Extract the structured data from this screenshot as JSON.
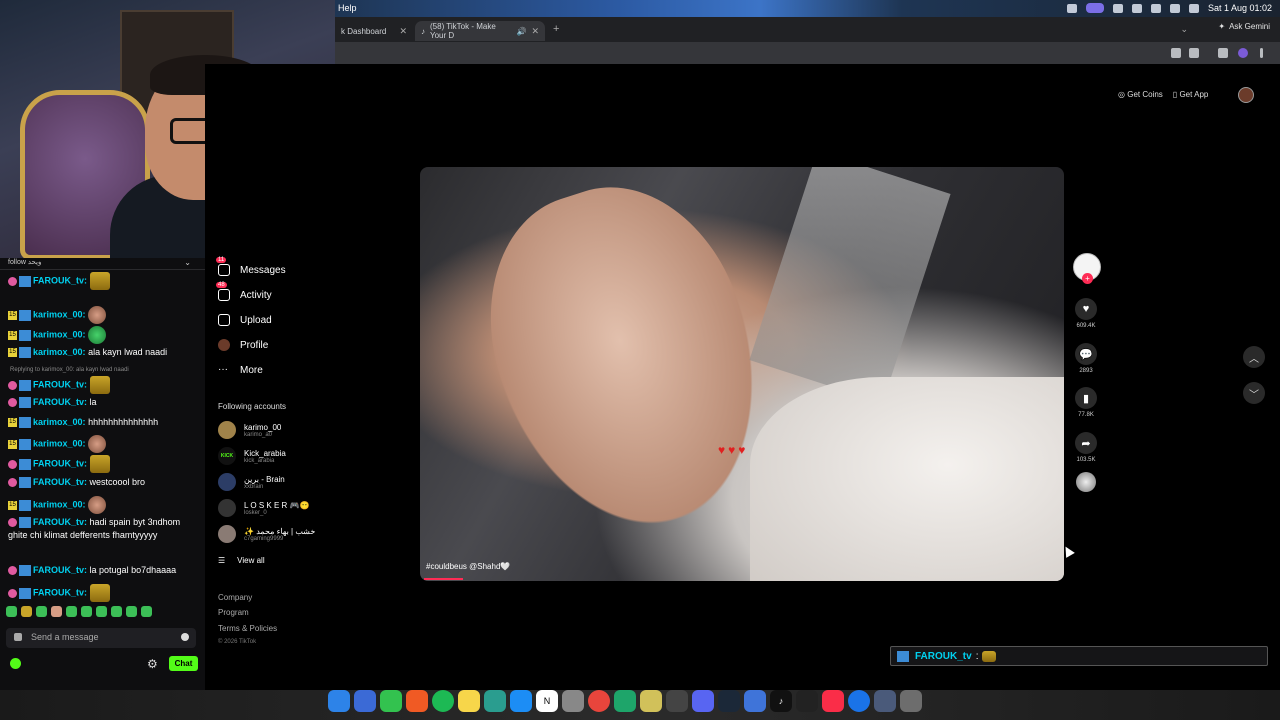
{
  "menubar": {
    "help": "Help",
    "datetime": "Sat 1 Aug  01:02"
  },
  "tabs": [
    {
      "label": "k Dashboard"
    },
    {
      "label": "(58) TikTok - Make Your D"
    }
  ],
  "browser": {
    "ask_gemini": "Ask Gemini"
  },
  "chat": {
    "header": "follow ویحد",
    "messages": [
      {
        "user": "FAROUK_tv:",
        "text": ""
      },
      {
        "user": "karimox_00:",
        "text": ""
      },
      {
        "user": "karimox_00:",
        "text": ""
      },
      {
        "user": "karimox_00:",
        "text": "ala kayn lwad naadi"
      },
      {
        "reply": "Replying to karimox_00: ala kayn lwad naadi"
      },
      {
        "user": "FAROUK_tv:",
        "text": ""
      },
      {
        "user": "FAROUK_tv:",
        "text": "la"
      },
      {
        "user": "karimox_00:",
        "text": "hhhhhhhhhhhhhh"
      },
      {
        "user": "karimox_00:",
        "text": ""
      },
      {
        "user": "FAROUK_tv:",
        "text": ""
      },
      {
        "user": "FAROUK_tv:",
        "text": "westcoool bro"
      },
      {
        "user": "karimox_00:",
        "text": ""
      },
      {
        "user": "FAROUK_tv:",
        "text": "hadi spain byt 3ndhom ghite chi klimat defferents fhamtyyyyy"
      },
      {
        "user": "FAROUK_tv:",
        "text": "la potugal bo7dhaaaa"
      },
      {
        "user": "FAROUK_tv:",
        "text": ""
      }
    ],
    "placeholder": "Send a message",
    "chat_button": "Chat"
  },
  "sidebar": {
    "nav": [
      {
        "label": "Messages",
        "badge": "11"
      },
      {
        "label": "Activity",
        "badge": "48"
      },
      {
        "label": "Upload"
      },
      {
        "label": "Profile"
      },
      {
        "label": "More"
      }
    ],
    "following_title": "Following accounts",
    "accounts": [
      {
        "name": "karimo_00",
        "handle": "karimo_a0"
      },
      {
        "name": "Kick_arabia",
        "handle": "kick_arabia"
      },
      {
        "name": "برين - Brain",
        "handle": "xxbrain"
      },
      {
        "name": "L O S K E R 🎮😶",
        "handle": "losker_0"
      },
      {
        "name": "✨ خشب | بهاء محمد",
        "handle": "c7gaming9999"
      }
    ],
    "view_all": "View all",
    "footer": [
      "Company",
      "Program",
      "Terms & Policies"
    ],
    "copyright": "© 2026 TikTok"
  },
  "topright": {
    "coins": "Get Coins",
    "app": "Get App"
  },
  "video": {
    "caption": "#couldbeus @Shahd🤍",
    "hearts": "♥♥♥",
    "progress": 0.06
  },
  "actions": {
    "likes": "609.4K",
    "comments": "2893",
    "saves": "77.8K",
    "shares": "103.5K"
  },
  "overlay": {
    "user": "FAROUK_tv",
    "sep": ":"
  },
  "colors": {
    "accent": "#fe2c55",
    "kick": "#53fc18",
    "twitch_user": "#00d1f0"
  }
}
